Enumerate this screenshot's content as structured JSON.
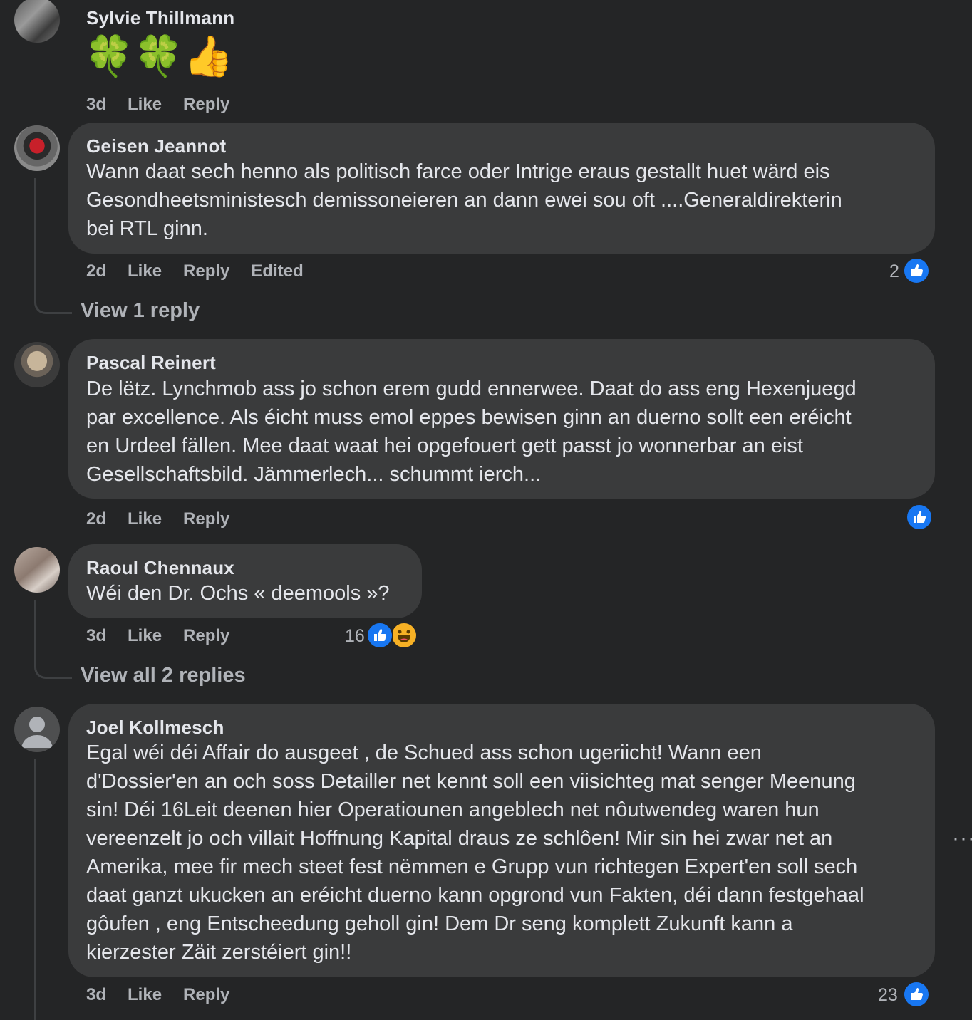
{
  "colors": {
    "background": "#242526",
    "bubble": "#3a3b3c",
    "text": "#e4e6eb",
    "meta": "#b0b3b8",
    "like_blue": "#1877f2"
  },
  "comments": [
    {
      "name": "Sylvie Thillmann",
      "text": "🍀🍀👍",
      "time": "3d",
      "like": "Like",
      "reply": "Reply"
    },
    {
      "name": "Geisen Jeannot",
      "lines": [
        "Wann daat sech henno als politisch farce oder Intrige eraus gestallt huet wärd eis",
        "Gesondheetsministesch demissoneieren an dann ewei sou oft ....Generaldirekterin",
        "bei RTL ginn."
      ],
      "time": "2d",
      "like": "Like",
      "reply": "Reply",
      "edited": "Edited",
      "reactions": "2",
      "view_replies": "View 1 reply",
      "reaction_icon": "like-icon"
    },
    {
      "name": "Pascal Reinert",
      "lines": [
        "De lëtz. Lynchmob ass jo schon erem gudd ennerwee. Daat do ass eng Hexenjuegd",
        "par excellence. Als éicht muss emol eppes bewisen ginn an duerno sollt een eréicht",
        "en Urdeel fällen. Mee daat waat hei opgefouert gett passt jo wonnerbar an eist",
        "Gesellschaftsbild. Jämmerlech... schummt ierch..."
      ],
      "time": "2d",
      "like": "Like",
      "reply": "Reply",
      "reaction_icon": "like-icon"
    },
    {
      "name": "Raoul Chennaux",
      "text": "Wéi den Dr. Ochs « deemools »?",
      "time": "3d",
      "like": "Like",
      "reply": "Reply",
      "reactions": "16",
      "view_replies": "View all 2 replies",
      "reaction_icons": [
        "like-icon",
        "haha-icon"
      ]
    },
    {
      "name": "Joel Kollmesch",
      "lines": [
        "Egal wéi déi Affair do ausgeet , de Schued ass schon ugeriicht! Wann een",
        "d'Dossier'en an och soss Detailler net kennt soll een viisichteg mat senger Meenung",
        "sin! Déi 16Leit deenen hier Operatiounen angeblech net nôutwendeg waren hun",
        "vereenzelt jo och villait Hoffnung Kapital draus ze schlôen! Mir sin hei zwar net an",
        "Amerika, mee fir mech steet fest nëmmen e Grupp vun richtegen Expert'en soll sech",
        "daat ganzt ukucken an eréicht duerno kann opgrond vun Fakten, déi dann festgehaal",
        "gôufen , eng Entscheedung geholl gin! Dem Dr seng komplett Zukunft kann a",
        "kierzester Zäit zerstéiert gin!!"
      ],
      "time": "3d",
      "like": "Like",
      "reply": "Reply",
      "reactions": "23",
      "reaction_icon": "like-icon",
      "more": "···"
    }
  ]
}
